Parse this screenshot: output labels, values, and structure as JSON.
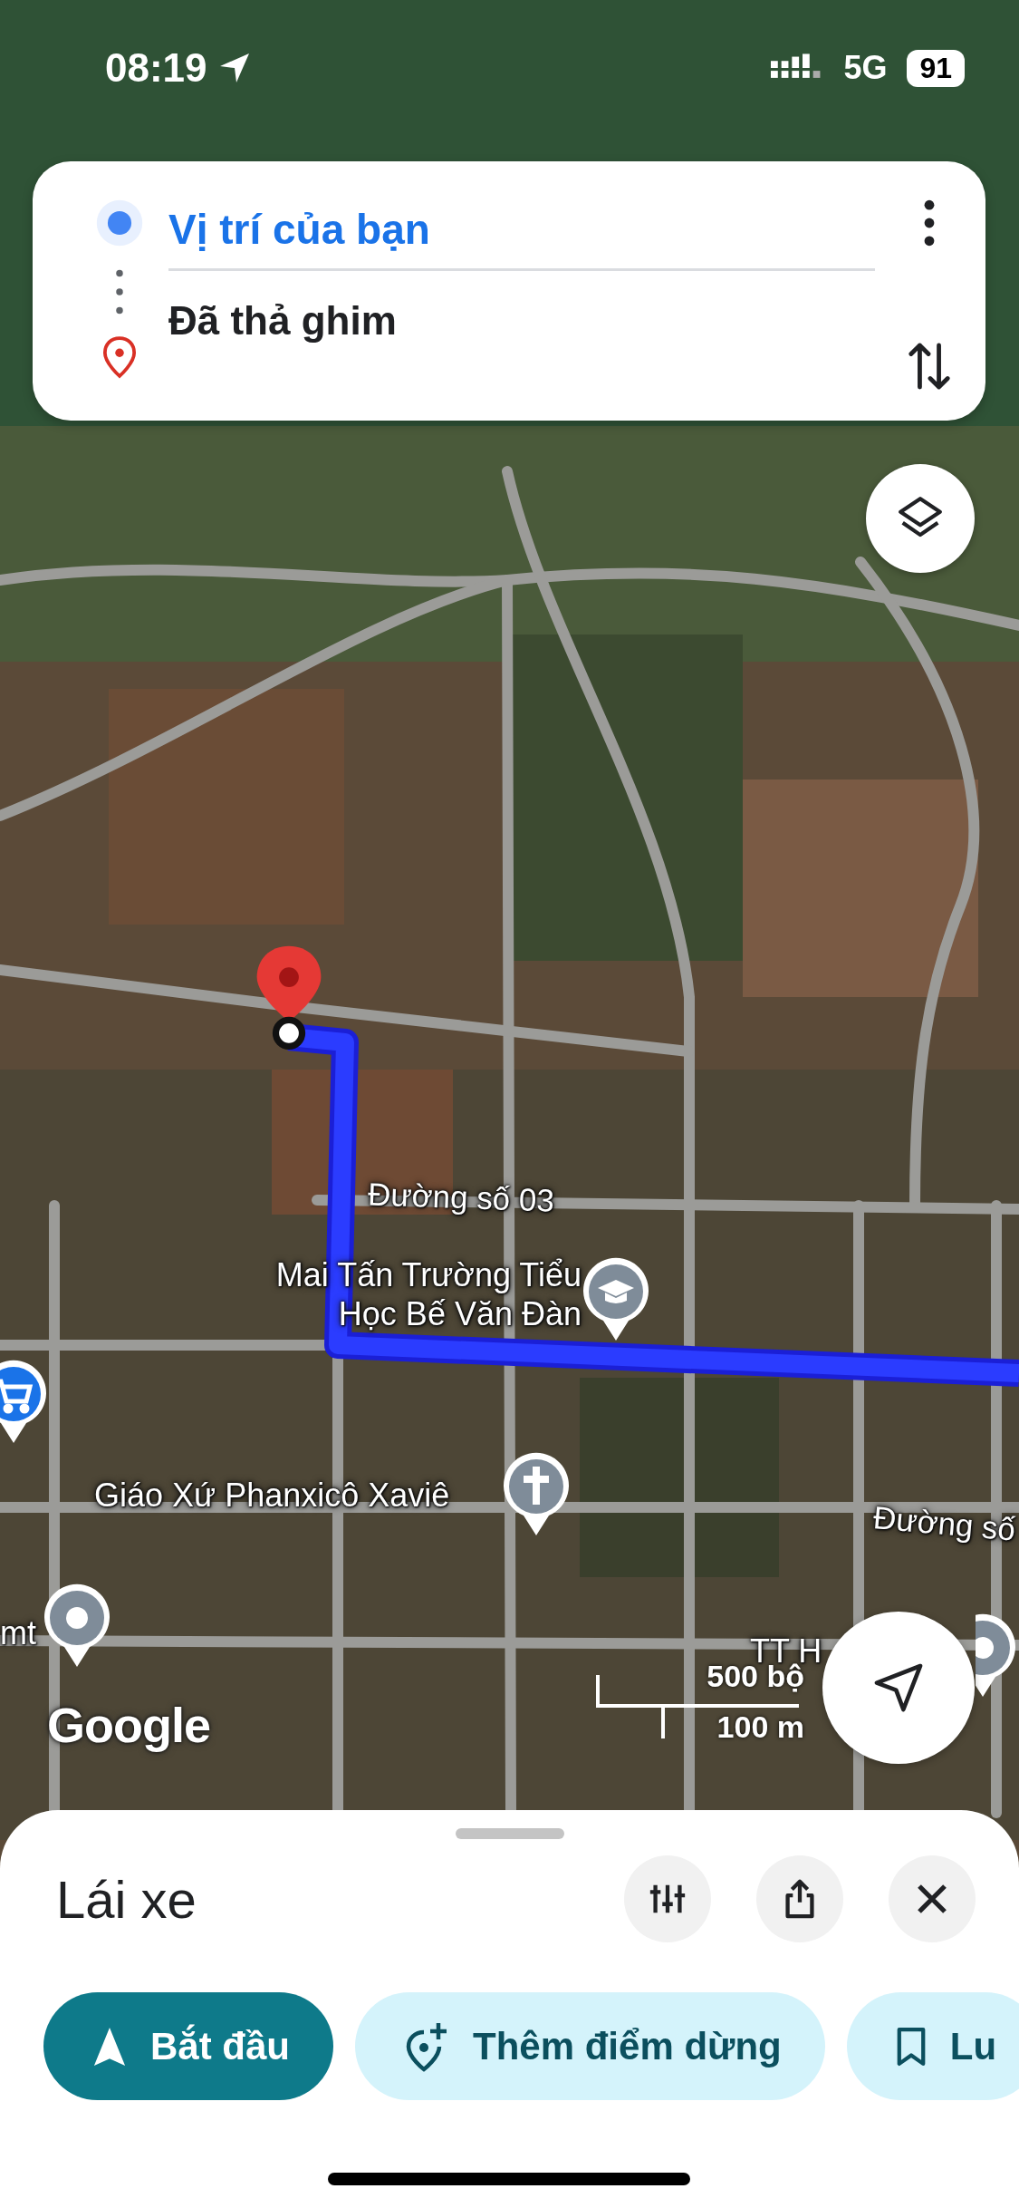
{
  "status_bar": {
    "time": "08:19",
    "network": "5G",
    "battery": "91"
  },
  "route_card": {
    "origin": "Vị trí của bạn",
    "destination": "Đã thả ghim"
  },
  "map": {
    "labels": [
      {
        "text": "Đường số 03",
        "kind": "road"
      },
      {
        "text": "Mai Tấn Trường Tiểu Học Bế Văn Đàn",
        "kind": "place"
      },
      {
        "text": "Giáo Xứ Phanxicô Xaviê",
        "kind": "place"
      },
      {
        "text": "Đường số",
        "kind": "road"
      },
      {
        "text": "mt",
        "kind": "place"
      },
      {
        "text": "TT H",
        "kind": "place"
      }
    ],
    "pins": [
      {
        "kind": "school"
      },
      {
        "kind": "shop"
      },
      {
        "kind": "church"
      },
      {
        "kind": "place"
      },
      {
        "kind": "place"
      }
    ],
    "attribution": "Google",
    "scale": {
      "imperial": "500 bộ",
      "metric": "100 m"
    }
  },
  "sheet": {
    "title": "Lái xe",
    "actions": [
      {
        "kind": "start",
        "label": "Bắt đầu"
      },
      {
        "kind": "add_stop",
        "label": "Thêm điểm dừng"
      },
      {
        "kind": "save",
        "label": "Lu"
      }
    ]
  }
}
